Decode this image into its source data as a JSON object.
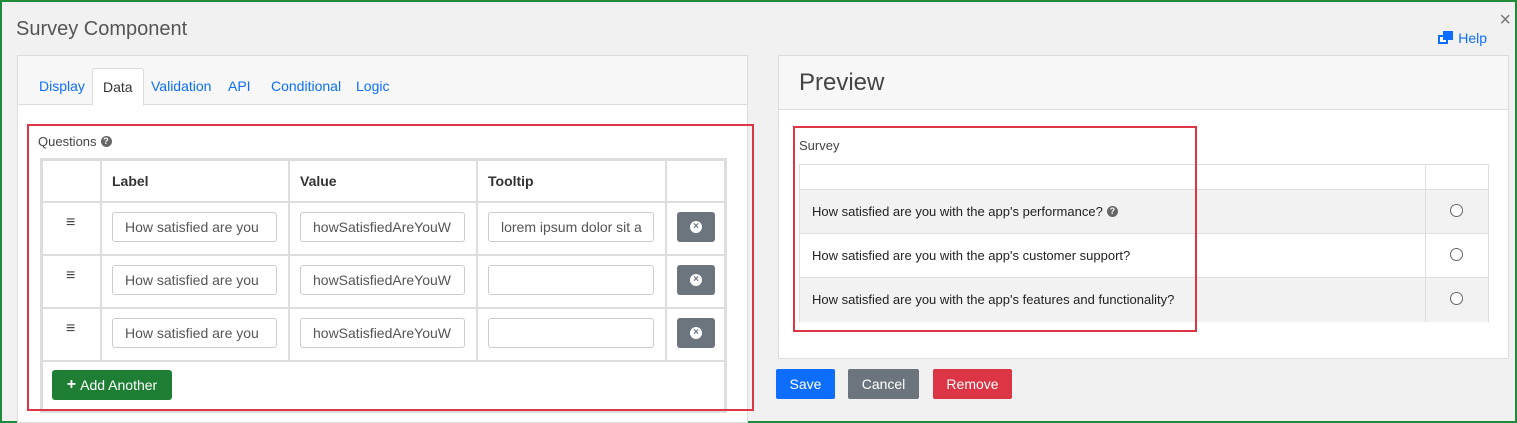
{
  "modal": {
    "title": "Survey Component",
    "close_symbol": "×",
    "help_label": "Help"
  },
  "tabs": [
    {
      "label": "Display"
    },
    {
      "label": "Data"
    },
    {
      "label": "Validation"
    },
    {
      "label": "API"
    },
    {
      "label": "Conditional"
    },
    {
      "label": "Logic"
    }
  ],
  "active_tab": "Data",
  "questions": {
    "label": "Questions",
    "headers": {
      "label": "Label",
      "value": "Value",
      "tooltip": "Tooltip"
    },
    "rows": [
      {
        "label": "How satisfied are you",
        "value": "howSatisfiedAreYouW",
        "tooltip": "lorem ipsum dolor sit a"
      },
      {
        "label": "How satisfied are you",
        "value": "howSatisfiedAreYouW",
        "tooltip": ""
      },
      {
        "label": "How satisfied are you",
        "value": "howSatisfiedAreYouW",
        "tooltip": ""
      }
    ],
    "add_label": "Add Another",
    "drag_symbol": "≡"
  },
  "preview": {
    "title": "Preview",
    "survey_label": "Survey",
    "questions": [
      {
        "text": "How satisfied are you with the app's performance?",
        "has_tooltip": true
      },
      {
        "text": "How satisfied are you with the app's customer support?",
        "has_tooltip": false
      },
      {
        "text": "How satisfied are you with the app's features and functionality?",
        "has_tooltip": false
      }
    ]
  },
  "actions": {
    "save": "Save",
    "cancel": "Cancel",
    "remove": "Remove"
  },
  "colors": {
    "modal_border": "#1f8a3a",
    "link": "#0d6efd",
    "add_button": "#1e7e34",
    "save_button": "#0d6efd",
    "cancel_button": "#6c757d",
    "remove_button": "#dc3545",
    "highlight_box": "#dc3545"
  },
  "icons": {
    "help": "external-window-icon",
    "tooltip": "question-circle-icon",
    "delete": "remove-circle-icon",
    "add": "plus-icon",
    "drag": "drag-handle-icon"
  }
}
